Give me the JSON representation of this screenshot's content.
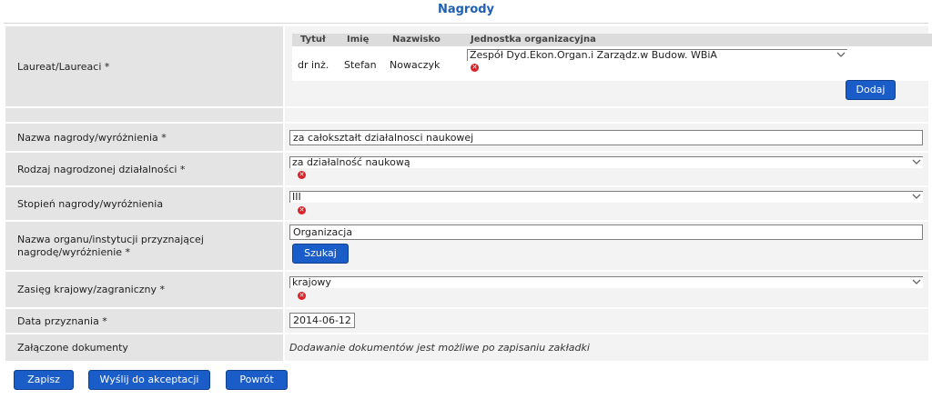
{
  "page": {
    "title": "Nagrody"
  },
  "laureat": {
    "label": "Laureat/Laureaci *",
    "columns": [
      "Tytuł",
      "Imię",
      "Nazwisko",
      "Jednostka organizacyjna"
    ],
    "row": {
      "title": "dr inż.",
      "first_name": "Stefan",
      "last_name": "Nowaczyk",
      "unit": "Zespół Dyd.Ekon.Organ.i Zarządz.w Budow. WBiA"
    },
    "add_label": "Dodaj"
  },
  "fields": {
    "award_name": {
      "label": "Nazwa nagrody/wyróżnienia *",
      "value": "za całokształt działalnosci naukowej"
    },
    "activity_type": {
      "label": "Rodzaj nagrodzonej działalności *",
      "value": "za działalność naukową"
    },
    "award_degree": {
      "label": "Stopień nagrody/wyróżnienia",
      "value": "III"
    },
    "institution": {
      "label_line1": "Nazwa organu/instytucji przyznającej",
      "label_line2": "nagrodę/wyróżnienie *",
      "value": "Organizacja",
      "search_label": "Szukaj"
    },
    "scope": {
      "label": "Zasięg krajowy/zagraniczny *",
      "value": "krajowy"
    },
    "date": {
      "label": "Data przyznania *",
      "value": "2014-06-12"
    },
    "documents": {
      "label": "Załączone dokumenty",
      "hint": "Dodawanie dokumentów jest możliwe po zapisaniu zakładki"
    }
  },
  "actions": {
    "save": "Zapisz",
    "send": "Wyślij do akceptacji",
    "back": "Powrót"
  },
  "colors": {
    "accent": "#1a5cc8",
    "label_bg": "#e4e4e4",
    "value_bg": "#f3f3f3",
    "error": "#d8232a"
  },
  "icons": {
    "remove": "remove-x-icon",
    "dropdown": "dropdown-arrow-icon"
  }
}
